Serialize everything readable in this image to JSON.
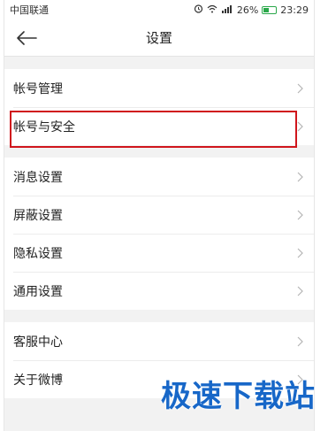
{
  "status_bar": {
    "carrier": "中国联通",
    "battery": "26%",
    "time": "23:29"
  },
  "header": {
    "title": "设置"
  },
  "groups": [
    {
      "items": [
        "帐号管理",
        "帐号与安全"
      ]
    },
    {
      "items": [
        "消息设置",
        "屏蔽设置",
        "隐私设置",
        "通用设置"
      ]
    },
    {
      "items": [
        "客服中心",
        "关于微博"
      ]
    }
  ],
  "watermark": "极速下载站",
  "colors": {
    "highlight": "#d0151c",
    "watermark": "#1767c8"
  }
}
